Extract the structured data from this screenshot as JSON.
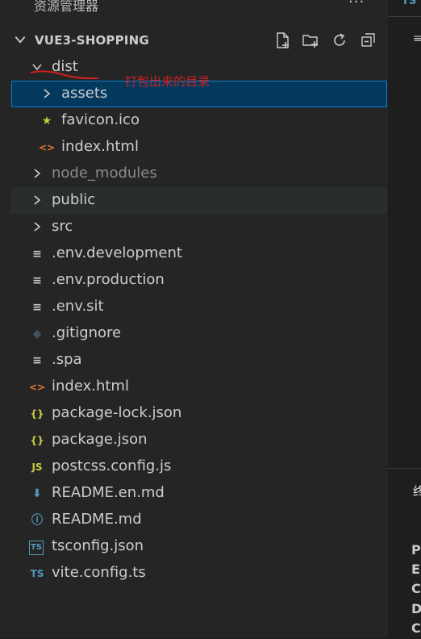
{
  "explorer": {
    "title": "资源管理器",
    "more_label": "···",
    "root": "VUE3-SHOPPING",
    "toolbar": {
      "new_file": "new-file",
      "new_folder": "new-folder",
      "refresh": "refresh",
      "collapse": "collapse-all"
    },
    "items": [
      {
        "label": "dist",
        "type": "folder",
        "expanded": true,
        "depth": 1
      },
      {
        "label": "assets",
        "type": "folder",
        "expanded": false,
        "depth": 2,
        "selected": true
      },
      {
        "label": "favicon.ico",
        "type": "favicon",
        "depth": 2
      },
      {
        "label": "index.html",
        "type": "html",
        "depth": 2
      },
      {
        "label": "node_modules",
        "type": "folder",
        "expanded": false,
        "depth": 1,
        "dim": true
      },
      {
        "label": "public",
        "type": "folder",
        "expanded": false,
        "depth": 1,
        "hover": true
      },
      {
        "label": "src",
        "type": "folder",
        "expanded": false,
        "depth": 1
      },
      {
        "label": ".env.development",
        "type": "text",
        "depth": 1
      },
      {
        "label": ".env.production",
        "type": "text",
        "depth": 1
      },
      {
        "label": ".env.sit",
        "type": "text",
        "depth": 1
      },
      {
        "label": ".gitignore",
        "type": "git",
        "depth": 1
      },
      {
        "label": ".spa",
        "type": "text",
        "depth": 1
      },
      {
        "label": "index.html",
        "type": "html",
        "depth": 1
      },
      {
        "label": "package-lock.json",
        "type": "json",
        "depth": 1
      },
      {
        "label": "package.json",
        "type": "json",
        "depth": 1
      },
      {
        "label": "postcss.config.js",
        "type": "js",
        "depth": 1
      },
      {
        "label": "README.en.md",
        "type": "md-download",
        "depth": 1
      },
      {
        "label": "README.md",
        "type": "info",
        "depth": 1
      },
      {
        "label": "tsconfig.json",
        "type": "ts-config",
        "depth": 1
      },
      {
        "label": "vite.config.ts",
        "type": "ts",
        "depth": 1
      }
    ]
  },
  "annotation": "打包出来的目录",
  "editor": {
    "tab_label": "TS",
    "right_glyph": "≡"
  },
  "terminal": {
    "tab_label": "终",
    "lines": [
      "P",
      "E",
      "C",
      "D",
      "C"
    ]
  },
  "colors": {
    "selection": "#04395e",
    "selection_border": "#007fd4",
    "annotation": "#d02020",
    "html_icon": "#e37933",
    "json_icon": "#cbcb41",
    "js_icon": "#cbcb41",
    "ts_icon": "#519aba",
    "favicon_icon": "#cbcb41"
  }
}
